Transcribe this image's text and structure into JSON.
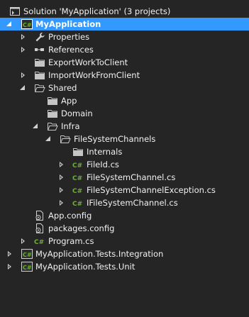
{
  "solution": {
    "label": "Solution 'MyApplication' (3 projects)",
    "icon": "solution-icon"
  },
  "nodes": [
    {
      "label": "MyApplication",
      "icon": "csharp-project-icon",
      "state": "expanded",
      "selected": true
    },
    {
      "label": "Properties",
      "icon": "wrench-icon",
      "state": "collapsed"
    },
    {
      "label": "References",
      "icon": "references-icon",
      "state": "collapsed"
    },
    {
      "label": "ExportWorkToClient",
      "icon": "folder-icon",
      "state": "none"
    },
    {
      "label": "ImportWorkFromClient",
      "icon": "folder-icon",
      "state": "collapsed"
    },
    {
      "label": "Shared",
      "icon": "folder-open-icon",
      "state": "expanded"
    },
    {
      "label": "App",
      "icon": "folder-icon",
      "state": "none"
    },
    {
      "label": "Domain",
      "icon": "folder-icon",
      "state": "none"
    },
    {
      "label": "Infra",
      "icon": "folder-open-icon",
      "state": "expanded"
    },
    {
      "label": "FileSystemChannels",
      "icon": "folder-open-icon",
      "state": "expanded"
    },
    {
      "label": "Internals",
      "icon": "folder-icon",
      "state": "none"
    },
    {
      "label": "FileId.cs",
      "icon": "csharp-file-icon",
      "state": "collapsed"
    },
    {
      "label": "FileSystemChannel.cs",
      "icon": "csharp-file-icon",
      "state": "collapsed"
    },
    {
      "label": "FileSystemChannelException.cs",
      "icon": "csharp-file-icon",
      "state": "collapsed"
    },
    {
      "label": "IFileSystemChannel.cs",
      "icon": "csharp-file-icon",
      "state": "collapsed"
    },
    {
      "label": "App.config",
      "icon": "config-file-icon",
      "state": "none"
    },
    {
      "label": "packages.config",
      "icon": "config-file-icon",
      "state": "none"
    },
    {
      "label": "Program.cs",
      "icon": "csharp-file-icon",
      "state": "collapsed"
    },
    {
      "label": "MyApplication.Tests.Integration",
      "icon": "csharp-project-icon",
      "state": "collapsed"
    },
    {
      "label": "MyApplication.Tests.Unit",
      "icon": "csharp-project-icon",
      "state": "collapsed"
    }
  ],
  "colors": {
    "background": "#252526",
    "text": "#f1f1f1",
    "selection": "#3399ff",
    "csharp": "#68b723",
    "folder": "#c5c5c5"
  }
}
